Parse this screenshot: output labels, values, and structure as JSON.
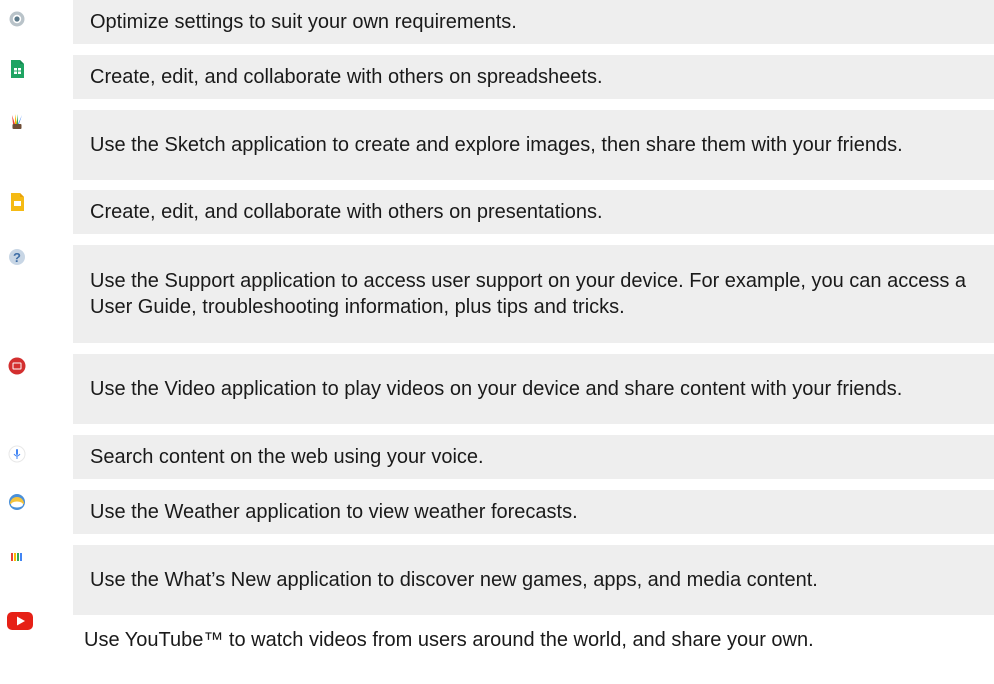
{
  "items": [
    {
      "icon": "settings-icon",
      "text": "Optimize settings to suit your own requirements."
    },
    {
      "icon": "sheets-icon",
      "text": "Create, edit, and collaborate with others on spreadsheets."
    },
    {
      "icon": "sketch-icon",
      "text": "Use the Sketch application to create and explore images, then share them with your friends."
    },
    {
      "icon": "slides-icon",
      "text": "Create, edit, and collaborate with others on presentations."
    },
    {
      "icon": "support-icon",
      "text": "Use the Support application to access user support on your device. For example, you can access a User Guide, troubleshooting information, plus tips and tricks."
    },
    {
      "icon": "video-icon",
      "text": "Use the Video application to play videos on your device and share content with your friends."
    },
    {
      "icon": "voice-search-icon",
      "text": "Search content on the web using your voice."
    },
    {
      "icon": "weather-icon",
      "text": "Use the Weather application to view weather forecasts."
    },
    {
      "icon": "whats-new-icon",
      "text": "Use the What’s New application to discover new games, apps, and media content."
    },
    {
      "icon": "youtube-icon",
      "text": "Use YouTube™ to watch videos from users around the world, and share your own."
    }
  ],
  "colors": {
    "row_background": "#eeeeee",
    "text": "#1a1a1a",
    "youtube_red": "#e62117",
    "sheets_green": "#1fa463",
    "slides_yellow": "#f5ba14"
  }
}
